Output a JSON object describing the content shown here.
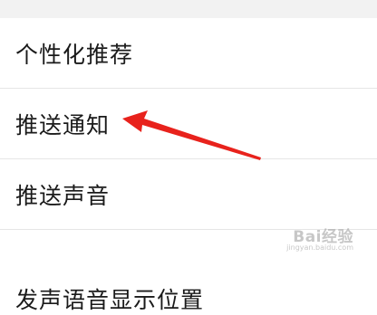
{
  "settings": {
    "items": [
      {
        "label": "个性化推荐"
      },
      {
        "label": "推送通知"
      },
      {
        "label": "推送声音"
      },
      {
        "label": "发声语音显示位置"
      }
    ]
  },
  "annotation": {
    "arrow_color": "#e8221c"
  },
  "watermark": {
    "brand": "Bai经验",
    "url": "jingyan.baidu.com"
  }
}
